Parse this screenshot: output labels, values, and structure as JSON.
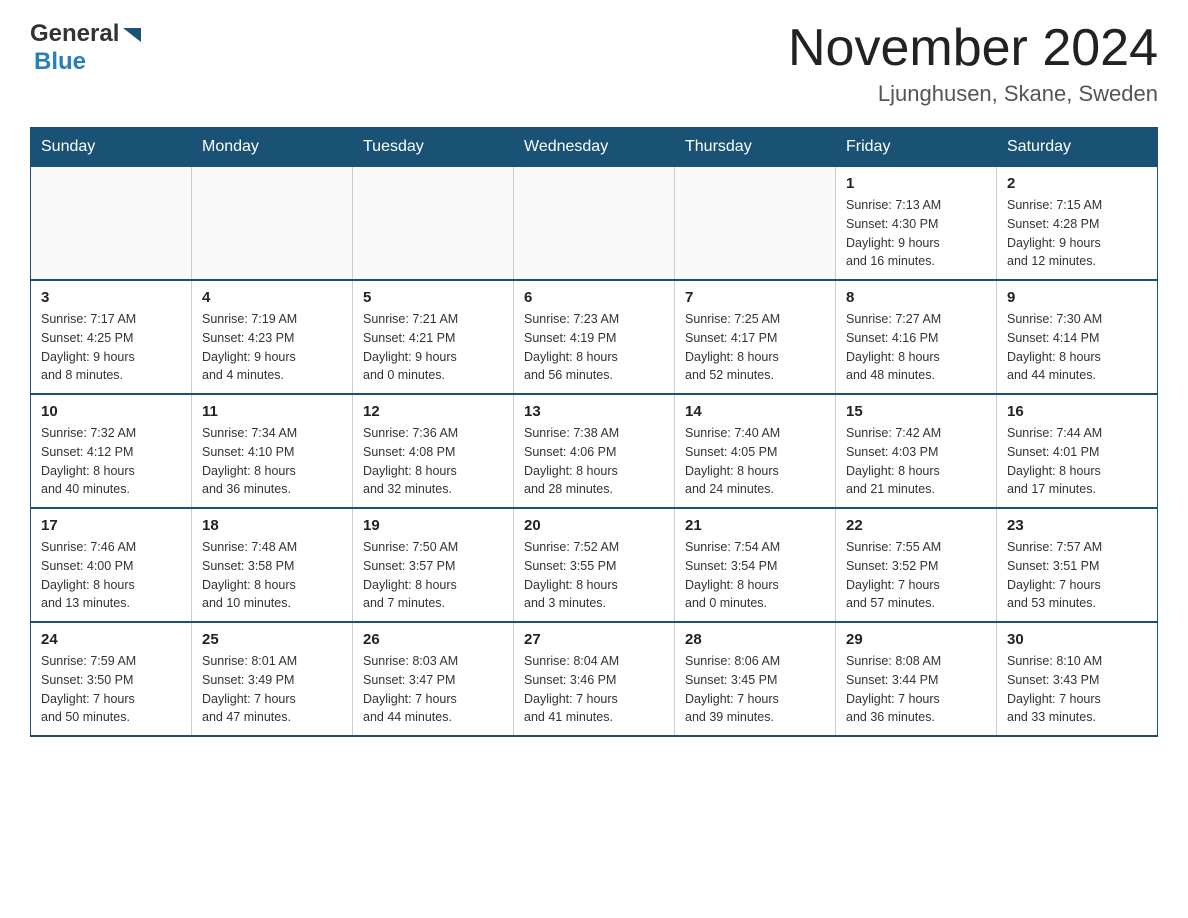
{
  "header": {
    "logo_general": "General",
    "logo_blue": "Blue",
    "title": "November 2024",
    "subtitle": "Ljunghusen, Skane, Sweden"
  },
  "days_of_week": [
    "Sunday",
    "Monday",
    "Tuesday",
    "Wednesday",
    "Thursday",
    "Friday",
    "Saturday"
  ],
  "weeks": [
    [
      {
        "day": "",
        "info": ""
      },
      {
        "day": "",
        "info": ""
      },
      {
        "day": "",
        "info": ""
      },
      {
        "day": "",
        "info": ""
      },
      {
        "day": "",
        "info": ""
      },
      {
        "day": "1",
        "info": "Sunrise: 7:13 AM\nSunset: 4:30 PM\nDaylight: 9 hours\nand 16 minutes."
      },
      {
        "day": "2",
        "info": "Sunrise: 7:15 AM\nSunset: 4:28 PM\nDaylight: 9 hours\nand 12 minutes."
      }
    ],
    [
      {
        "day": "3",
        "info": "Sunrise: 7:17 AM\nSunset: 4:25 PM\nDaylight: 9 hours\nand 8 minutes."
      },
      {
        "day": "4",
        "info": "Sunrise: 7:19 AM\nSunset: 4:23 PM\nDaylight: 9 hours\nand 4 minutes."
      },
      {
        "day": "5",
        "info": "Sunrise: 7:21 AM\nSunset: 4:21 PM\nDaylight: 9 hours\nand 0 minutes."
      },
      {
        "day": "6",
        "info": "Sunrise: 7:23 AM\nSunset: 4:19 PM\nDaylight: 8 hours\nand 56 minutes."
      },
      {
        "day": "7",
        "info": "Sunrise: 7:25 AM\nSunset: 4:17 PM\nDaylight: 8 hours\nand 52 minutes."
      },
      {
        "day": "8",
        "info": "Sunrise: 7:27 AM\nSunset: 4:16 PM\nDaylight: 8 hours\nand 48 minutes."
      },
      {
        "day": "9",
        "info": "Sunrise: 7:30 AM\nSunset: 4:14 PM\nDaylight: 8 hours\nand 44 minutes."
      }
    ],
    [
      {
        "day": "10",
        "info": "Sunrise: 7:32 AM\nSunset: 4:12 PM\nDaylight: 8 hours\nand 40 minutes."
      },
      {
        "day": "11",
        "info": "Sunrise: 7:34 AM\nSunset: 4:10 PM\nDaylight: 8 hours\nand 36 minutes."
      },
      {
        "day": "12",
        "info": "Sunrise: 7:36 AM\nSunset: 4:08 PM\nDaylight: 8 hours\nand 32 minutes."
      },
      {
        "day": "13",
        "info": "Sunrise: 7:38 AM\nSunset: 4:06 PM\nDaylight: 8 hours\nand 28 minutes."
      },
      {
        "day": "14",
        "info": "Sunrise: 7:40 AM\nSunset: 4:05 PM\nDaylight: 8 hours\nand 24 minutes."
      },
      {
        "day": "15",
        "info": "Sunrise: 7:42 AM\nSunset: 4:03 PM\nDaylight: 8 hours\nand 21 minutes."
      },
      {
        "day": "16",
        "info": "Sunrise: 7:44 AM\nSunset: 4:01 PM\nDaylight: 8 hours\nand 17 minutes."
      }
    ],
    [
      {
        "day": "17",
        "info": "Sunrise: 7:46 AM\nSunset: 4:00 PM\nDaylight: 8 hours\nand 13 minutes."
      },
      {
        "day": "18",
        "info": "Sunrise: 7:48 AM\nSunset: 3:58 PM\nDaylight: 8 hours\nand 10 minutes."
      },
      {
        "day": "19",
        "info": "Sunrise: 7:50 AM\nSunset: 3:57 PM\nDaylight: 8 hours\nand 7 minutes."
      },
      {
        "day": "20",
        "info": "Sunrise: 7:52 AM\nSunset: 3:55 PM\nDaylight: 8 hours\nand 3 minutes."
      },
      {
        "day": "21",
        "info": "Sunrise: 7:54 AM\nSunset: 3:54 PM\nDaylight: 8 hours\nand 0 minutes."
      },
      {
        "day": "22",
        "info": "Sunrise: 7:55 AM\nSunset: 3:52 PM\nDaylight: 7 hours\nand 57 minutes."
      },
      {
        "day": "23",
        "info": "Sunrise: 7:57 AM\nSunset: 3:51 PM\nDaylight: 7 hours\nand 53 minutes."
      }
    ],
    [
      {
        "day": "24",
        "info": "Sunrise: 7:59 AM\nSunset: 3:50 PM\nDaylight: 7 hours\nand 50 minutes."
      },
      {
        "day": "25",
        "info": "Sunrise: 8:01 AM\nSunset: 3:49 PM\nDaylight: 7 hours\nand 47 minutes."
      },
      {
        "day": "26",
        "info": "Sunrise: 8:03 AM\nSunset: 3:47 PM\nDaylight: 7 hours\nand 44 minutes."
      },
      {
        "day": "27",
        "info": "Sunrise: 8:04 AM\nSunset: 3:46 PM\nDaylight: 7 hours\nand 41 minutes."
      },
      {
        "day": "28",
        "info": "Sunrise: 8:06 AM\nSunset: 3:45 PM\nDaylight: 7 hours\nand 39 minutes."
      },
      {
        "day": "29",
        "info": "Sunrise: 8:08 AM\nSunset: 3:44 PM\nDaylight: 7 hours\nand 36 minutes."
      },
      {
        "day": "30",
        "info": "Sunrise: 8:10 AM\nSunset: 3:43 PM\nDaylight: 7 hours\nand 33 minutes."
      }
    ]
  ]
}
